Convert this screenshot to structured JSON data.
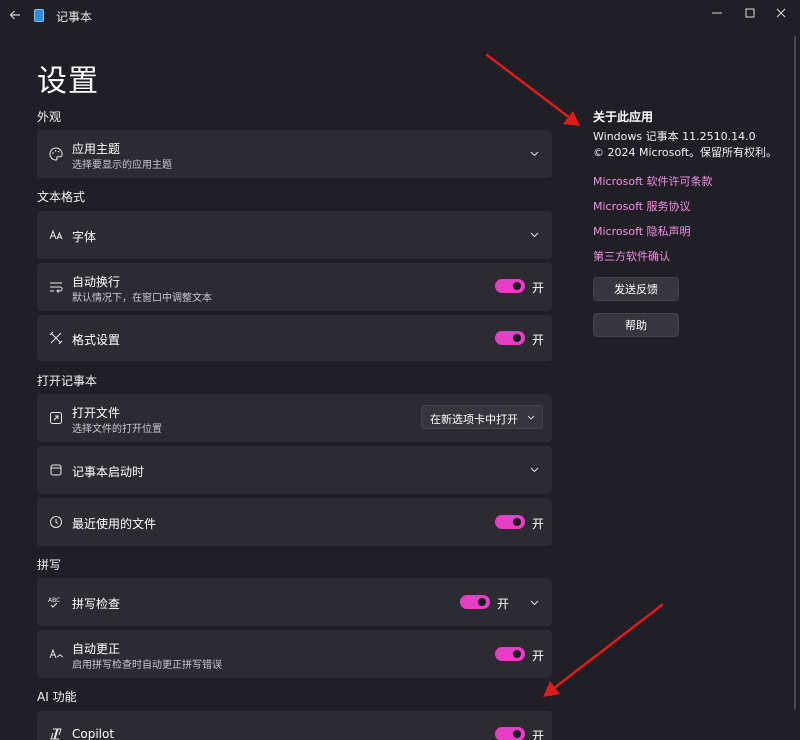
{
  "window": {
    "title": "记事本",
    "page_title": "设置"
  },
  "sections": {
    "appearance": "外观",
    "text_format": "文本格式",
    "open_notepad": "打开记事本",
    "spelling": "拼写",
    "ai": "AI 功能"
  },
  "settings": {
    "theme": {
      "title": "应用主题",
      "sub": "选择要显示的应用主题"
    },
    "font": {
      "title": "字体"
    },
    "wrap": {
      "title": "自动换行",
      "sub": "默认情况下，在窗口中调整文本",
      "state": "开"
    },
    "format": {
      "title": "格式设置",
      "state": "开"
    },
    "open_file": {
      "title": "打开文件",
      "sub": "选择文件的打开位置",
      "dropdown": "在新选项卡中打开"
    },
    "startup": {
      "title": "记事本启动时"
    },
    "recent": {
      "title": "最近使用的文件",
      "state": "开"
    },
    "spellcheck": {
      "title": "拼写检查",
      "state": "开"
    },
    "autocorrect": {
      "title": "自动更正",
      "sub": "启用拼写检查时自动更正拼写错误",
      "state": "开"
    },
    "copilot": {
      "title": "Copilot",
      "state": "开"
    }
  },
  "about": {
    "title": "关于此应用",
    "version": "Windows 记事本 11.2510.14.0",
    "copyright": "© 2024 Microsoft。保留所有权利。",
    "links": [
      "Microsoft 软件许可条款",
      "Microsoft 服务协议",
      "Microsoft 隐私声明",
      "第三方软件确认"
    ],
    "feedback_button": "发送反馈",
    "help_button": "帮助"
  },
  "colors": {
    "accent": "#e63ec4",
    "link": "#f08fe4",
    "annotation_arrow": "#e01b1b",
    "background": "#201f26",
    "card": "#2c2b32"
  }
}
